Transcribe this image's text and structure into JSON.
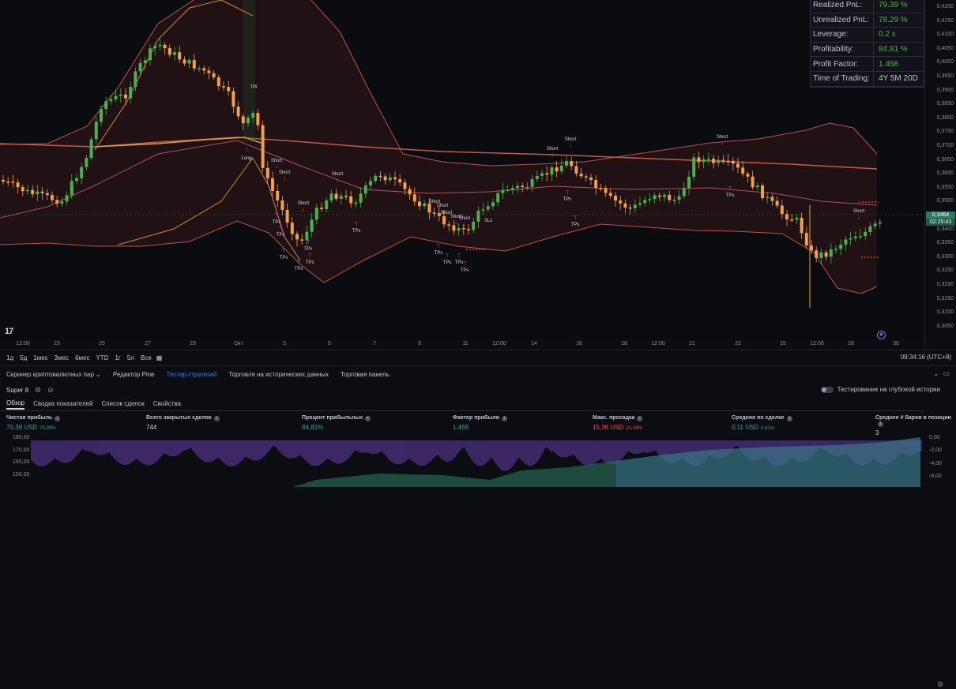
{
  "price_axis": {
    "ticks": [
      "0,4200",
      "0,4150",
      "0,4100",
      "0,4050",
      "0,4000",
      "0,3950",
      "0,3900",
      "0,3850",
      "0,3800",
      "0,3750",
      "0,3700",
      "0,3650",
      "0,3600",
      "0,3550",
      "0,3500",
      "0,3450",
      "0,3400",
      "0,3350",
      "0,3300",
      "0,3250",
      "0,3200",
      "0,3150",
      "0,3100",
      "0,3050"
    ],
    "current_price": "0,3464",
    "countdown": "02:25:43"
  },
  "time_axis": {
    "ticks": [
      "12:00",
      "23",
      "25",
      "27",
      "29",
      "Окт",
      "3",
      "5",
      "7",
      "9",
      "11",
      "12:00",
      "14",
      "16",
      "18",
      "12:00",
      "21",
      "23",
      "25",
      "12:00",
      "28",
      "30"
    ]
  },
  "stats_panel": [
    {
      "label": "Realized PnL:",
      "value": "79.39 %",
      "color": "#4caf50"
    },
    {
      "label": "Unrealized PnL:",
      "value": "78.29 %",
      "color": "#4caf50"
    },
    {
      "label": "Leverage:",
      "value": "0.2 x",
      "color": "#4caf50"
    },
    {
      "label": "Profitability:",
      "value": "84.81 %",
      "color": "#4caf50"
    },
    {
      "label": "Profit Factor:",
      "value": "1.468",
      "color": "#4caf50"
    },
    {
      "label": "Time of Trading:",
      "value": "4Y 5M 20D",
      "color": "#c2c4cb"
    }
  ],
  "chart_annotations": {
    "short_label": "Short",
    "long_label": "Long",
    "tp_label": "TPs",
    "sl_label": "SLs",
    "tpl_label": "TPl"
  },
  "logo_text": "17",
  "range_bar": {
    "ranges": [
      "1д",
      "5д",
      "1мес",
      "3мес",
      "6мес",
      "YTD",
      "1г",
      "5л",
      "Все"
    ],
    "timezone": "09:34:16 (UTC+8)"
  },
  "bottom_tabs": {
    "items": [
      "Скринер криптовалютных пар",
      "Редактор Pine",
      "Тестер стратегий",
      "Торговля на исторических данных",
      "Торговая панель"
    ],
    "active_index": 2
  },
  "strategy": {
    "name": "Super 8",
    "deep_test_label": "Тестирование на глубокой истории"
  },
  "sub_tabs": {
    "items": [
      "Обзор",
      "Сводка показателей",
      "Список сделок",
      "Свойства"
    ],
    "active_index": 0
  },
  "metrics": [
    {
      "label": "Чистая прибыль",
      "value": "79,39 USD",
      "sub": "79,39%",
      "color": "green"
    },
    {
      "label": "Всего закрытых сделок",
      "value": "744",
      "sub": "",
      "color": "white"
    },
    {
      "label": "Процент прибыльных",
      "value": "84,81%",
      "sub": "",
      "color": "green"
    },
    {
      "label": "Фактор прибыли",
      "value": "1,468",
      "sub": "",
      "color": "green"
    },
    {
      "label": "Макс. просадка",
      "value": "15,36 USD",
      "sub": "10,19%",
      "color": "red"
    },
    {
      "label": "Средняя по сделке",
      "value": "0,11 USD",
      "sub": "0,41%",
      "color": "green"
    },
    {
      "label": "Среднее # баров в позиции",
      "value": "3",
      "sub": "",
      "color": "white"
    }
  ],
  "equity_axis": {
    "left_ticks": [
      "180,00",
      "170,00",
      "160,00",
      "150,00"
    ],
    "right_ticks": [
      "0,00",
      "-2,00",
      "-4,00",
      "-6,00"
    ]
  },
  "colors": {
    "bull": "#4caf50",
    "bear": "#f0a04b",
    "short_red": "#e53935",
    "tp_magenta": "#e040fb",
    "band": "#c0504d",
    "accent_blue": "#2f80ed"
  }
}
